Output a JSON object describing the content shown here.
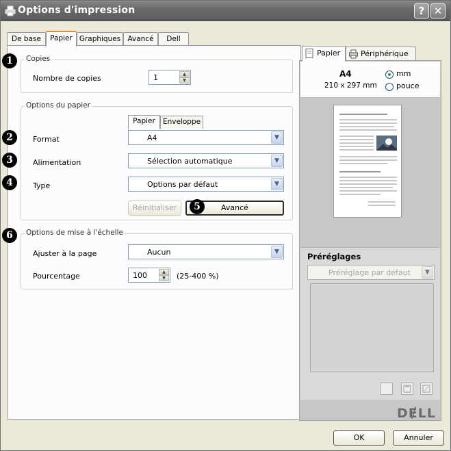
{
  "window": {
    "title": "Options d'impression",
    "help_label": "?",
    "close_label": "✕"
  },
  "tabs": [
    {
      "label": "De base"
    },
    {
      "label": "Papier"
    },
    {
      "label": "Graphiques"
    },
    {
      "label": "Avancé"
    },
    {
      "label": "Dell"
    }
  ],
  "copies": {
    "group_title": "Copies",
    "label": "Nombre de copies",
    "value": "1"
  },
  "paper_options": {
    "group_title": "Options du papier",
    "subtabs": [
      {
        "label": "Papier"
      },
      {
        "label": "Enveloppe"
      }
    ],
    "format_label": "Format",
    "format_value": "A4",
    "source_label": "Alimentation",
    "source_value": "Sélection automatique",
    "type_label": "Type",
    "type_value": "Options par défaut",
    "reset_label": "Réinitialiser",
    "advanced_label": "Avancé"
  },
  "scaling": {
    "group_title": "Options de mise à l'échelle",
    "fit_label": "Ajuster à la page",
    "fit_value": "Aucun",
    "percent_label": "Pourcentage",
    "percent_value": "100",
    "percent_range": "(25-400 %)"
  },
  "badges": [
    "❶",
    "❷",
    "❸",
    "❹",
    "❺",
    "❻"
  ],
  "side": {
    "tabs": [
      {
        "label": "Papier",
        "icon": "page-icon"
      },
      {
        "label": "Périphérique",
        "icon": "printer-icon"
      }
    ],
    "paper_name": "A4",
    "paper_size": "210 x 297 mm",
    "unit_mm": "mm",
    "unit_inch": "pouce",
    "presets_title": "Préréglages",
    "preset_value": "Préréglage par défaut",
    "brand": "DɆLL"
  },
  "footer": {
    "ok_label": "OK",
    "cancel_label": "Annuler"
  }
}
